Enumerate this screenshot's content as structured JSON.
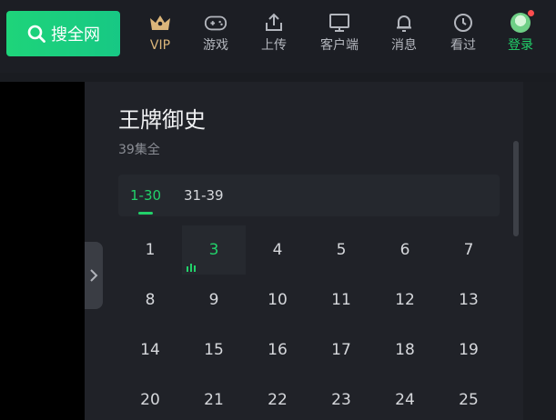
{
  "header": {
    "search_label": "搜全网",
    "nav": {
      "vip": "VIP",
      "games": "游戏",
      "upload": "上传",
      "client": "客户端",
      "messages": "消息",
      "history": "看过",
      "login": "登录"
    }
  },
  "series": {
    "title": "王牌御史",
    "subtitle": "39集全"
  },
  "tabs": [
    "1-30",
    "31-39"
  ],
  "active_tab": "1-30",
  "episodes": [
    "1",
    "3",
    "4",
    "5",
    "6",
    "7",
    "8",
    "9",
    "10",
    "11",
    "12",
    "13",
    "14",
    "15",
    "16",
    "17",
    "18",
    "19",
    "20",
    "21",
    "22",
    "23",
    "24",
    "25"
  ],
  "active_episode": "3",
  "colors": {
    "accent": "#22d16a",
    "vip": "#dcb67a"
  }
}
